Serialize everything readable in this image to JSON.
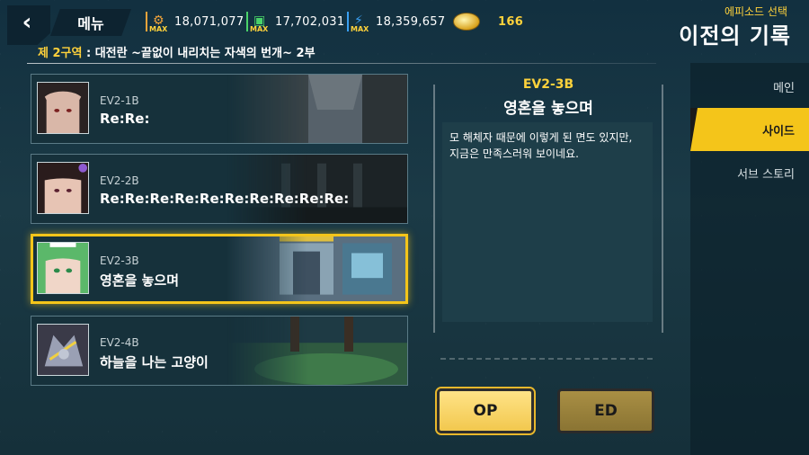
{
  "header": {
    "menu_label": "메뉴",
    "resources": [
      {
        "icon": "gear-max-icon",
        "badge": "MAX",
        "value": "18,071,077",
        "color": "#f2a43a"
      },
      {
        "icon": "chip-max-icon",
        "badge": "MAX",
        "value": "17,702,031",
        "color": "#4ad26a"
      },
      {
        "icon": "bolt-max-icon",
        "badge": "MAX",
        "value": "18,359,657",
        "color": "#3aa0f2"
      }
    ],
    "coin": {
      "icon": "coin-icon",
      "value": "166"
    },
    "subtitle": "에피소드 선택",
    "title": "이전의 기록"
  },
  "region": {
    "prefix": "제 2구역",
    "text": " : 대전란 ~끝없이 내리치는 자색의 번개~ 2부"
  },
  "episodes": [
    {
      "code": "EV2-1B",
      "name": "Re:Re:"
    },
    {
      "code": "EV2-2B",
      "name": "Re:Re:Re:Re:Re:Re:Re:Re:Re:Re:"
    },
    {
      "code": "EV2-3B",
      "name": "영혼을 놓으며"
    },
    {
      "code": "EV2-4B",
      "name": "하늘을 나는 고양이"
    }
  ],
  "detail": {
    "code": "EV2-3B",
    "title": "영혼을 놓으며",
    "desc_line1": "모 해체자 때문에 이렇게 된 면도 있지만,",
    "desc_line2": "지금은 만족스러워 보이네요."
  },
  "buttons": {
    "op": "OP",
    "ed": "ED"
  },
  "side_nav": {
    "items": [
      "메인",
      "사이드",
      "서브 스토리"
    ],
    "active": "사이드"
  },
  "colors": {
    "accent": "#f4c51a",
    "highlight_text": "#ffd23b"
  }
}
